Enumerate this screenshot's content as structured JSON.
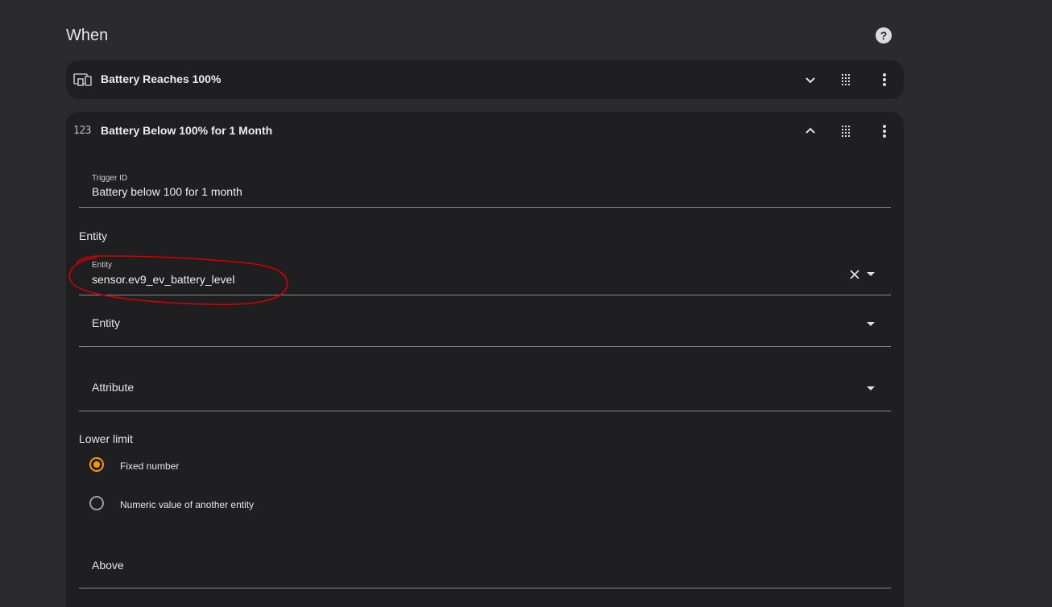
{
  "section": {
    "title": "When"
  },
  "triggers": [
    {
      "title": "Battery Reaches 100%",
      "icon": "devices-icon",
      "expand_icon": "chevron-down-icon"
    },
    {
      "title": "Battery Below 100% for 1 Month",
      "icon": "numeric-123-icon",
      "icon_text": "123",
      "expand_icon": "chevron-up-icon"
    }
  ],
  "form": {
    "trigger_id": {
      "label": "Trigger ID",
      "value": "Battery below 100 for 1 month"
    },
    "entity_group_label": "Entity",
    "entity": {
      "label": "Entity",
      "value": "sensor.ev9_ev_battery_level"
    },
    "entity2": {
      "placeholder": "Entity"
    },
    "attribute": {
      "placeholder": "Attribute"
    },
    "lower_limit_label": "Lower limit",
    "lower_limit_options": [
      {
        "label": "Fixed number",
        "selected": true
      },
      {
        "label": "Numeric value of another entity",
        "selected": false
      }
    ],
    "above": {
      "placeholder": "Above"
    }
  },
  "colors": {
    "background": "#2b2b2d",
    "card": "#1f1f21",
    "accent": "#ff9800",
    "annotation": "#d40000"
  }
}
